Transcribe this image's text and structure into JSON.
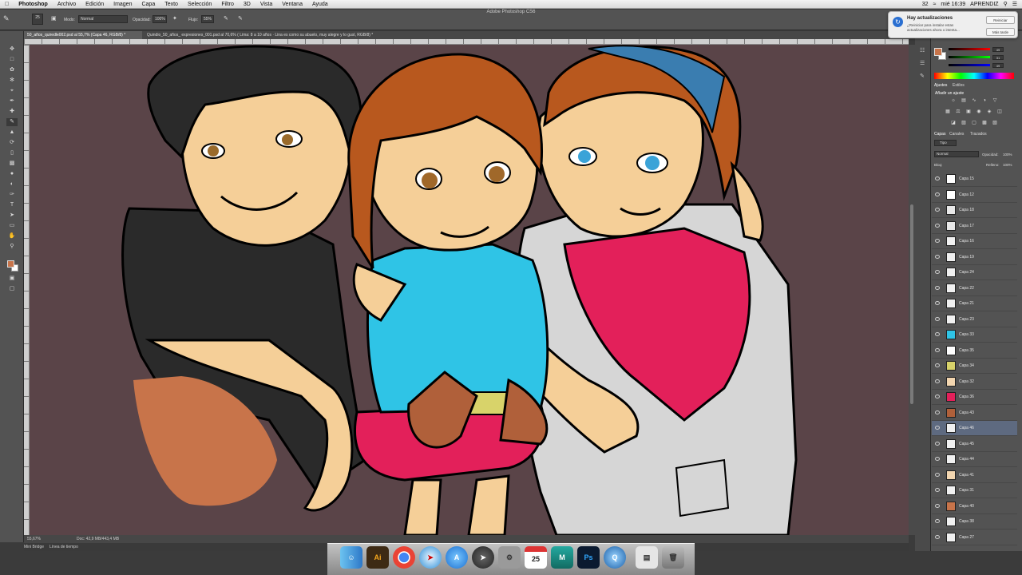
{
  "menubar": {
    "app": "Photoshop",
    "items": [
      "Archivo",
      "Edición",
      "Imagen",
      "Capa",
      "Texto",
      "Selección",
      "Filtro",
      "3D",
      "Vista",
      "Ventana",
      "Ayuda"
    ],
    "battery": "32",
    "clock": "mié 16:39",
    "user": "APRENDIZ"
  },
  "window_title": "Adobe Photoshop CS6",
  "options_bar": {
    "mode_label": "Modo:",
    "mode_value": "Normal",
    "opacity_label": "Opacidad:",
    "opacity_value": "100%",
    "flow_label": "Flujo:",
    "flow_value": "55%",
    "brush_size": "25"
  },
  "doc_tabs": [
    "50_años_quiredle002.psd al 55,7% (Capa 46, RGB/8) *",
    "Quindio_50_años_ expresiones_001.psd al 70,6% ( Lima: 8 a 10 años · Lina es como su abuelo, muy alegre y lo gusl, RGB/8) *"
  ],
  "status": {
    "zoom": "55,67%",
    "doc": "Doc: 42,9 MB/443,4 MB"
  },
  "bottom_tabs": [
    "Mini Bridge",
    "Línea de tiempo"
  ],
  "notification": {
    "title": "Hay actualizaciones",
    "body": "¿Reiniciar para instalar estas actualizaciones ahora o intenta...",
    "restart": "Reiniciar",
    "later": "Más tarde"
  },
  "color_panel": {
    "values": [
      "49",
      "31",
      "49"
    ]
  },
  "adjustments": {
    "tabs": [
      "Ajustes",
      "Estilos"
    ],
    "title": "Añadir un ajuste"
  },
  "layers_panel": {
    "tabs": [
      "Capas",
      "Canales",
      "Trazados"
    ],
    "filter_label": "Tipo",
    "blend": "Normal",
    "opacity_label": "Opacidad:",
    "opacity_value": "100%",
    "lock_label": "Bloq:",
    "fill_label": "Relleno:",
    "fill_value": "100%",
    "layers": [
      {
        "name": "Capa 15",
        "thumb": "#ffffff"
      },
      {
        "name": "Capa 12",
        "thumb": "#ffffff"
      },
      {
        "name": "Capa 18",
        "thumb": "#e8e8e8"
      },
      {
        "name": "Capa 17",
        "thumb": "#e8e8e8"
      },
      {
        "name": "Capa 16",
        "thumb": "#f0f0f0"
      },
      {
        "name": "Capa 19",
        "thumb": "#f0f0f0"
      },
      {
        "name": "Capa 24",
        "thumb": "#f0f0f0"
      },
      {
        "name": "Capa 22",
        "thumb": "#f0f0f0"
      },
      {
        "name": "Capa 21",
        "thumb": "#f0f0f0"
      },
      {
        "name": "Capa 23",
        "thumb": "#f0f0f0"
      },
      {
        "name": "Capa 33",
        "thumb": "#2fc4e6"
      },
      {
        "name": "Capa 35",
        "thumb": "#ffffff"
      },
      {
        "name": "Capa 34",
        "thumb": "#d8d36a"
      },
      {
        "name": "Capa 32",
        "thumb": "#f3d6b0"
      },
      {
        "name": "Capa 36",
        "thumb": "#e3205a"
      },
      {
        "name": "Capa 43",
        "thumb": "#b0603a"
      },
      {
        "name": "Capa 46",
        "thumb": "#f0f0f0",
        "selected": true
      },
      {
        "name": "Capa 45",
        "thumb": "#f0f0f0"
      },
      {
        "name": "Capa 44",
        "thumb": "#f0f0f0"
      },
      {
        "name": "Capa 41",
        "thumb": "#f3d6b0"
      },
      {
        "name": "Capa 31",
        "thumb": "#f0f0f0"
      },
      {
        "name": "Capa 40",
        "thumb": "#c8744a"
      },
      {
        "name": "Capa 38",
        "thumb": "#f0f0f0"
      },
      {
        "name": "Capa 27",
        "thumb": "#f0f0f0"
      }
    ]
  },
  "dock": [
    "Finder",
    "Ai",
    "Chrome",
    "Safari",
    "App Store",
    "Launchpad",
    "Preferencias",
    "Calendario",
    "Maya",
    "Ps",
    "QuickTime",
    "Vista previa",
    "Papelera"
  ],
  "dock_calendar_day": "25",
  "colors": {
    "canvas": "#5a4448",
    "skin": "#f5cf98",
    "hair_dark": "#2a2a2a",
    "hair_brown": "#b8581e",
    "shirt_blue": "#2fc4e6",
    "shirt_red": "#e3205a",
    "headband": "#3a7db0",
    "apron": "#d6d6d6"
  }
}
